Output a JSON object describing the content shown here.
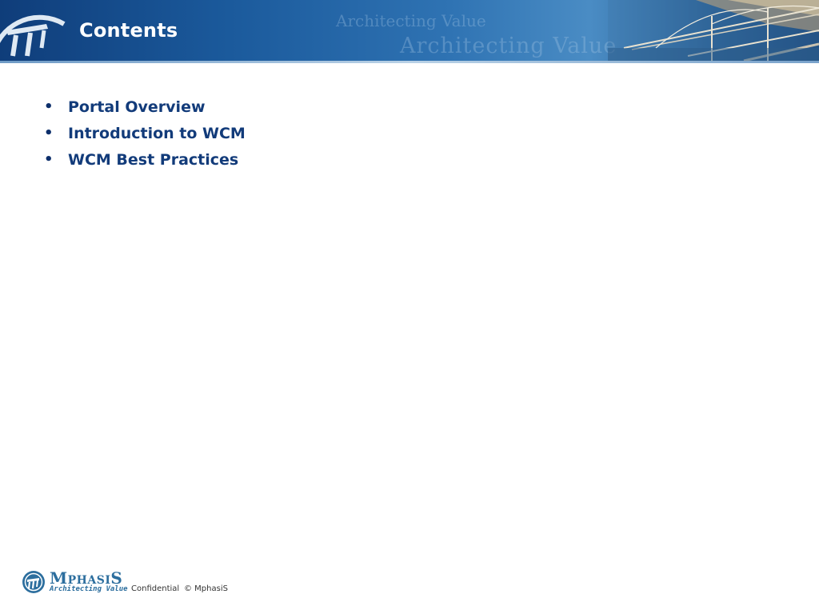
{
  "slide": {
    "title": "Contents",
    "watermark_small": "Architecting Value",
    "watermark_large": "Architecting Value"
  },
  "bullets": [
    {
      "text": "Portal Overview"
    },
    {
      "text": "Introduction to WCM"
    },
    {
      "text": "WCM Best Practices"
    }
  ],
  "bullet_symbol": "•",
  "footer": {
    "brand_first": "M",
    "brand_middle": "PHASI",
    "brand_last": "S",
    "tagline": "Architecting Value",
    "confidential": "Confidential",
    "copyright": "© MphasiS"
  },
  "colors": {
    "header_blue": "#1b5a9c",
    "bullet_text": "#123b7a",
    "brand": "#2c6e9e"
  }
}
